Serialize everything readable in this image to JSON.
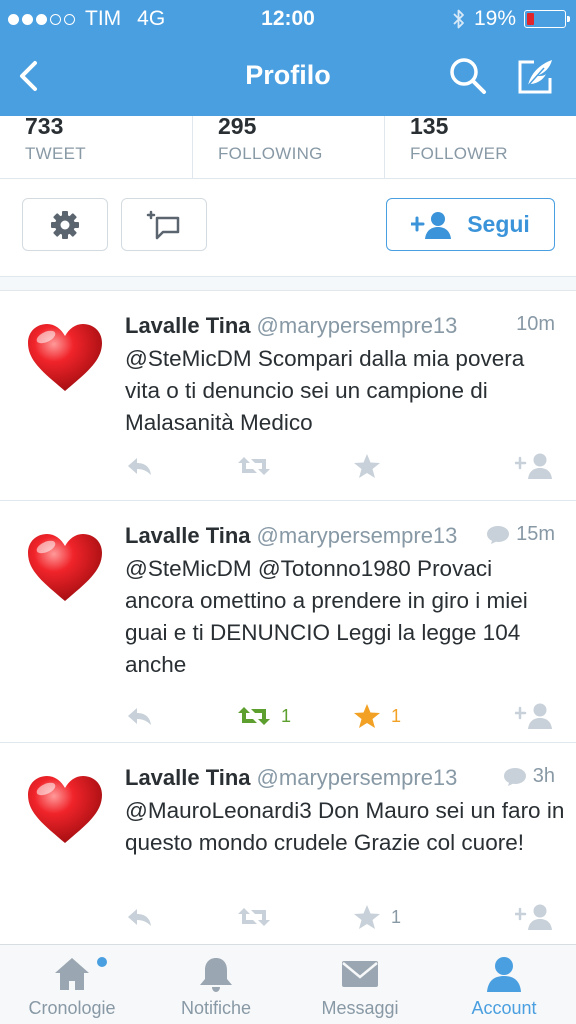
{
  "status_bar": {
    "carrier": "TIM",
    "network": "4G",
    "time": "12:00",
    "battery": "19%",
    "battery_level": 0.19,
    "battery_color": "#e0252b"
  },
  "nav": {
    "title": "Profilo",
    "back_icon": "chevron-left-icon",
    "search_icon": "search-icon",
    "compose_icon": "compose-icon"
  },
  "stats": [
    {
      "value": "733",
      "label": "TWEET"
    },
    {
      "value": "295",
      "label": "FOLLOWING"
    },
    {
      "value": "135",
      "label": "FOLLOWER"
    }
  ],
  "actions": {
    "settings_icon": "gear-icon",
    "message_icon": "add-message-icon",
    "follow_label": "Segui",
    "follow_icon": "add-user-icon"
  },
  "tweets": [
    {
      "name": "Lavalle Tina",
      "handle": "@marypersempre13",
      "time": "10m",
      "has_conversation": false,
      "text": "@SteMicDM Scompari dalla mia povera vita o ti denuncio sei un campione di Malasanità Medico",
      "retweets": "",
      "favorites": "",
      "retweeted": false,
      "favorited": false
    },
    {
      "name": "Lavalle Tina",
      "handle": "@marypersempre13",
      "time": "15m",
      "has_conversation": true,
      "text": "@SteMicDM @Totonno1980 Provaci ancora omettino a prendere in giro i miei guai e ti DENUNCIO Leggi la legge 104 anche",
      "retweets": "1",
      "favorites": "1",
      "retweeted": true,
      "favorited": true
    },
    {
      "name": "Lavalle Tina",
      "handle": "@marypersempre13",
      "time": "3h",
      "has_conversation": true,
      "text": "@MauroLeonardi3 Don Mauro sei un faro in questo mondo crudele Grazie col cuore!",
      "retweets": "",
      "favorites": "1",
      "retweeted": false,
      "favorited": false
    }
  ],
  "tabs": [
    {
      "label": "Cronologie",
      "icon": "home-icon",
      "active": false,
      "badge": true
    },
    {
      "label": "Notifiche",
      "icon": "bell-icon",
      "active": false,
      "badge": false
    },
    {
      "label": "Messaggi",
      "icon": "envelope-icon",
      "active": false,
      "badge": false
    },
    {
      "label": "Account",
      "icon": "person-icon",
      "active": true,
      "badge": false
    }
  ],
  "colors": {
    "brand": "#4a9fe0",
    "retweet_active": "#5c9f2e",
    "favorite_active": "#f2a125",
    "muted": "#8899a6"
  }
}
